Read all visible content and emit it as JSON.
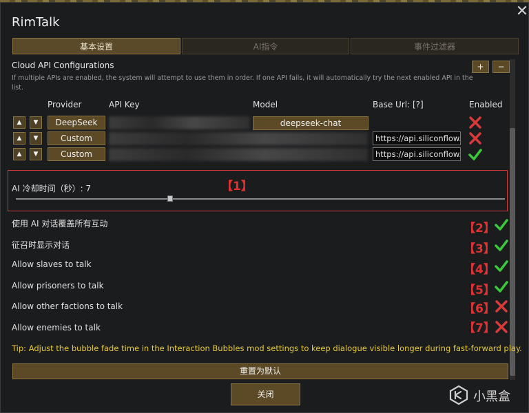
{
  "window": {
    "title": "RimTalk"
  },
  "tabs": [
    {
      "label": "基本设置",
      "active": true
    },
    {
      "label": "AI指令",
      "active": false
    },
    {
      "label": "事件过滤器",
      "active": false
    }
  ],
  "cloud_api": {
    "heading": "Cloud API Configurations",
    "help": "If multiple APIs are enabled, the system will attempt to use them in order. If one API fails, it will automatically try the next enabled API in the list.",
    "add_label": "+",
    "remove_label": "−",
    "columns": {
      "provider": "Provider",
      "api_key": "API Key",
      "model": "Model",
      "base_url": "Base Url: [?]",
      "enabled": "Enabled"
    },
    "rows": [
      {
        "up": "▲",
        "down": "▼",
        "provider": "DeepSeek",
        "model": "deepseek-chat",
        "base_url": "",
        "enabled": false
      },
      {
        "up": "▲",
        "down": "▼",
        "provider": "Custom",
        "model": "",
        "base_url": "https://api.siliconflow.cn",
        "enabled": false
      },
      {
        "up": "▲",
        "down": "▼",
        "provider": "Custom",
        "model": "",
        "base_url": "https://api.siliconflow.cn",
        "enabled": true
      }
    ]
  },
  "cooldown": {
    "label": "AI 冷却时间（秒）: 7",
    "value": 7,
    "marker": "【1】"
  },
  "toggles": [
    {
      "label": "使用 AI 对话覆盖所有互动",
      "marker": "【2】",
      "enabled": true
    },
    {
      "label": "征召时显示对话",
      "marker": "【3】",
      "enabled": true
    },
    {
      "label": "Allow slaves to talk",
      "marker": "【4】",
      "enabled": true
    },
    {
      "label": "Allow prisoners to talk",
      "marker": "【5】",
      "enabled": true
    },
    {
      "label": "Allow other factions to talk",
      "marker": "【6】",
      "enabled": false
    },
    {
      "label": "Allow enemies to talk",
      "marker": "【7】",
      "enabled": false
    }
  ],
  "tip": "Tip: Adjust the bubble fade time in the Interaction Bubbles mod settings to keep dialogue visible longer during fast-forward play.",
  "buttons": {
    "reset": "重置为默认",
    "close": "关闭"
  },
  "watermark": {
    "text": "小黑盒"
  },
  "colors": {
    "accent": "#5c4a26",
    "check": "#3cc83c",
    "cross": "#d83a3a",
    "marker": "#e03232",
    "tip": "#e6c83a"
  }
}
